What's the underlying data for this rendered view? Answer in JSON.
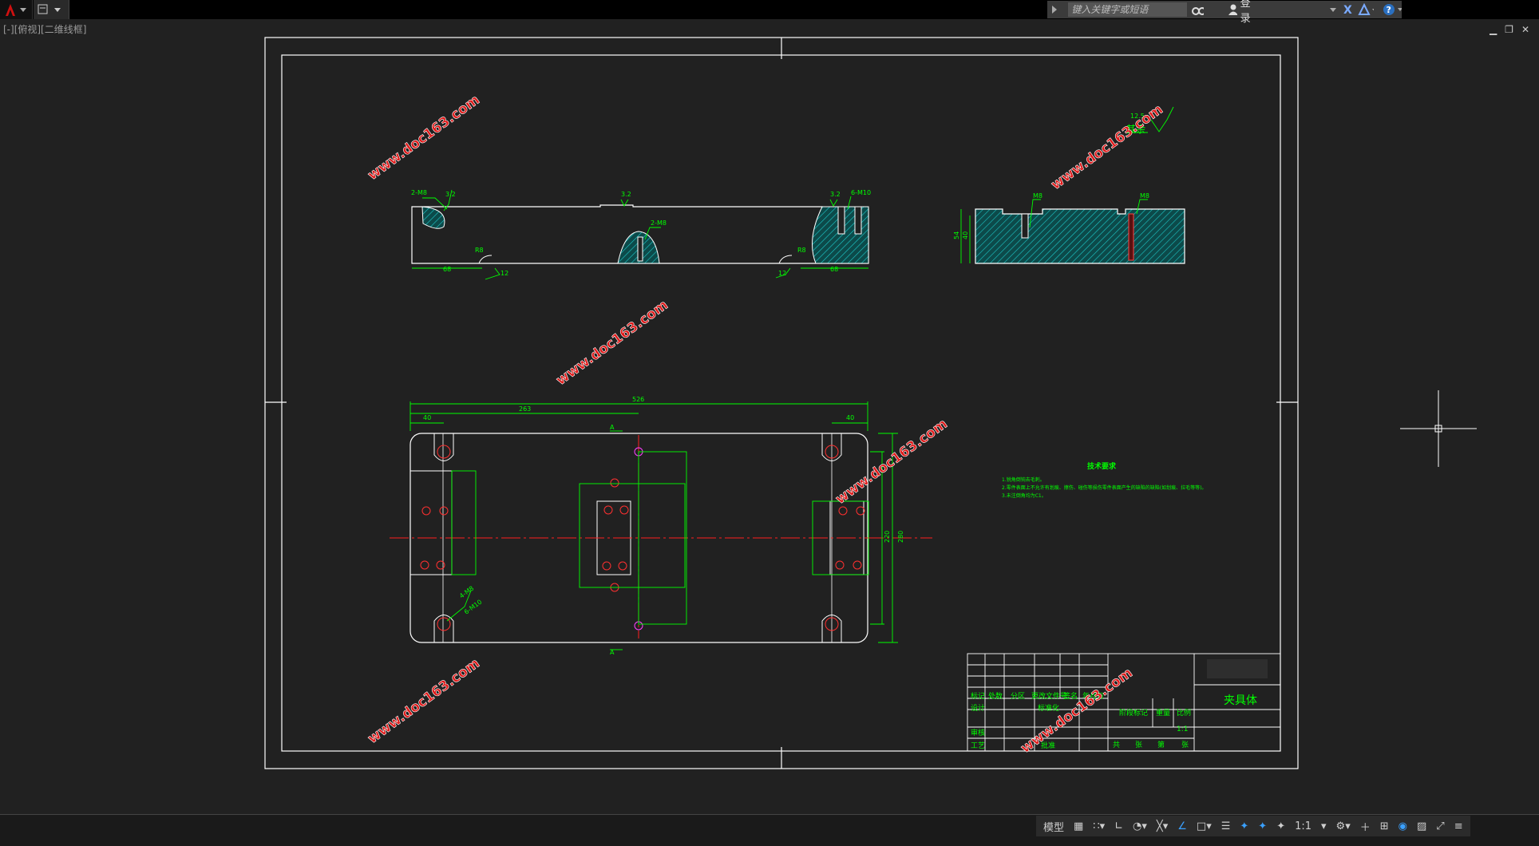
{
  "titlebar": {
    "search_placeholder": "键入关键字或短语",
    "login_label": "登录"
  },
  "viewport_label": "[-][俯视][二维线框]",
  "drawing": {
    "watermark": "www.doc163.com",
    "dims": {
      "top_left_2m8": "2-M8",
      "top_32": "3.2",
      "top_32b": "3.2",
      "top_32c": "3.2",
      "top_6m10": "6-M10",
      "top_2m8b": "2-M8",
      "top_r8": "R8",
      "top_12": "12",
      "top_12b": "12",
      "top_r8b": "R8",
      "top_68": "68",
      "top_68b": "68",
      "roughness": "12.5",
      "roughness_other": "其余",
      "side_m8": "M8",
      "side_m8b": "M8",
      "side_54": "54",
      "side_40": "40",
      "main_526": "526",
      "main_263": "263",
      "main_40": "40",
      "main_40b": "40",
      "main_a_top": "A",
      "main_a_bot": "A",
      "main_220": "220",
      "main_280": "280",
      "main_4m8": "4-M8",
      "main_6m10": "6-M10"
    },
    "tech": {
      "title": "技术要求",
      "line1": "1.锐角倒钝去毛刺。",
      "line2": "2.零件表面上不允许有划痕、擦伤、碰伤等损伤零件表面产生的缺陷的缺陷(如划痕、拉毛等等)。",
      "line3": "3.未注倒角均为C1。"
    },
    "titleblock": {
      "part_name": "夹具体",
      "c_mark": "标记",
      "c_count": "处数",
      "c_zone": "分区",
      "c_doc": "更改文件号",
      "c_sign": "签名",
      "c_date": "年月日",
      "design": "设计",
      "std": "标准化",
      "stage": "阶段标记",
      "weight": "重量",
      "scale": "比例",
      "scale_val": "1:1",
      "review": "审核",
      "process": "工艺",
      "approve": "批准",
      "total": "共",
      "sheets": "张",
      "page": "第",
      "sheet2": "张"
    }
  },
  "statusbar": {
    "model_label": "模型",
    "scale_label": "1:1"
  },
  "colors": {
    "bg": "#212121",
    "frame": "#ffffff",
    "dim": "#00ff00",
    "center": "#ff0000",
    "hatch": "#00b0b0"
  }
}
